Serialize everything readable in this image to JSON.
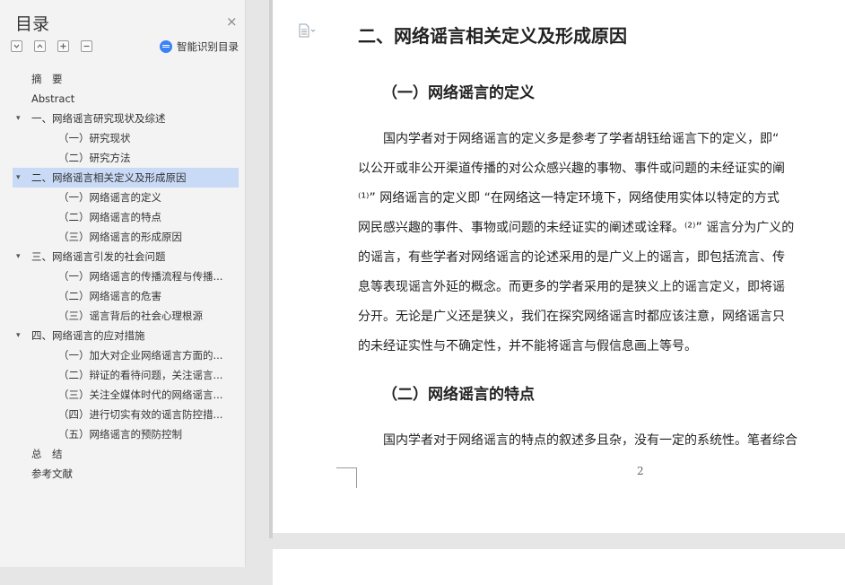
{
  "toc": {
    "title": "目录",
    "close_glyph": "×",
    "tools": [
      "collapse-all-icon",
      "expand-all-icon",
      "add-icon",
      "remove-icon"
    ],
    "smart_label": "智能识别目录",
    "items": [
      {
        "label": "摘　要",
        "level": 0,
        "arrow": ""
      },
      {
        "label": "Abstract",
        "level": 0,
        "arrow": ""
      },
      {
        "label": "一、网络谣言研究现状及综述",
        "level": 0,
        "arrow": "v"
      },
      {
        "label": "（一）研究现状",
        "level": 1,
        "arrow": ""
      },
      {
        "label": "（二）研究方法",
        "level": 1,
        "arrow": ""
      },
      {
        "label": "二、网络谣言相关定义及形成原因",
        "level": 0,
        "arrow": "v",
        "selected": true
      },
      {
        "label": "（一）网络谣言的定义",
        "level": 1,
        "arrow": ""
      },
      {
        "label": "（二）网络谣言的特点",
        "level": 1,
        "arrow": ""
      },
      {
        "label": "（三）网络谣言的形成原因",
        "level": 1,
        "arrow": ""
      },
      {
        "label": "三、网络谣言引发的社会问题",
        "level": 0,
        "arrow": "v"
      },
      {
        "label": "（一）网络谣言的传播流程与传播...",
        "level": 1,
        "arrow": ""
      },
      {
        "label": "（二）网络谣言的危害",
        "level": 1,
        "arrow": ""
      },
      {
        "label": "（三）谣言背后的社会心理根源",
        "level": 1,
        "arrow": ""
      },
      {
        "label": "四、网络谣言的应对措施",
        "level": 0,
        "arrow": "v"
      },
      {
        "label": "（一）加大对企业网络谣言方面的...",
        "level": 1,
        "arrow": ""
      },
      {
        "label": "（二）辩证的看待问题，关注谣言...",
        "level": 1,
        "arrow": ""
      },
      {
        "label": "（三）关注全媒体时代的网络谣言...",
        "level": 1,
        "arrow": ""
      },
      {
        "label": "（四）进行切实有效的谣言防控措...",
        "level": 1,
        "arrow": ""
      },
      {
        "label": "（五）网络谣言的预防控制",
        "level": 1,
        "arrow": ""
      },
      {
        "label": "总　结",
        "level": 0,
        "arrow": ""
      },
      {
        "label": "参考文献",
        "level": 0,
        "arrow": ""
      }
    ]
  },
  "document": {
    "heading2": "二、网络谣言相关定义及形成原因",
    "section1_title": "（一）网络谣言的定义",
    "section1_lines": [
      "　　国内学者对于网络谣言的定义多是参考了学者胡钰给谣言下的定义，即“",
      "以公开或非公开渠道传播的对公众感兴趣的事物、事件或问题的未经证实的阐",
      "⁽¹⁾” 网络谣言的定义即 “在网络这一特定环境下，网络使用实体以特定的方式",
      "网民感兴趣的事件、事物或问题的未经证实的阐述或诠释。⁽²⁾” 谣言分为广义的",
      "的谣言，有些学者对网络谣言的论述采用的是广义上的谣言，即包括流言、传",
      "息等表现谣言外延的概念。而更多的学者采用的是狭义上的谣言定义，即将谣",
      "分开。无论是广义还是狭义，我们在探究网络谣言时都应该注意，网络谣言只",
      "的未经证实性与不确定性，并不能将谣言与假信息画上等号。"
    ],
    "section2_title": "（二）网络谣言的特点",
    "section2_lines": [
      "　　国内学者对于网络谣言的特点的叙述多且杂，没有一定的系统性。笔者综合"
    ],
    "page_number": "2",
    "doc_icon": "document-icon"
  }
}
